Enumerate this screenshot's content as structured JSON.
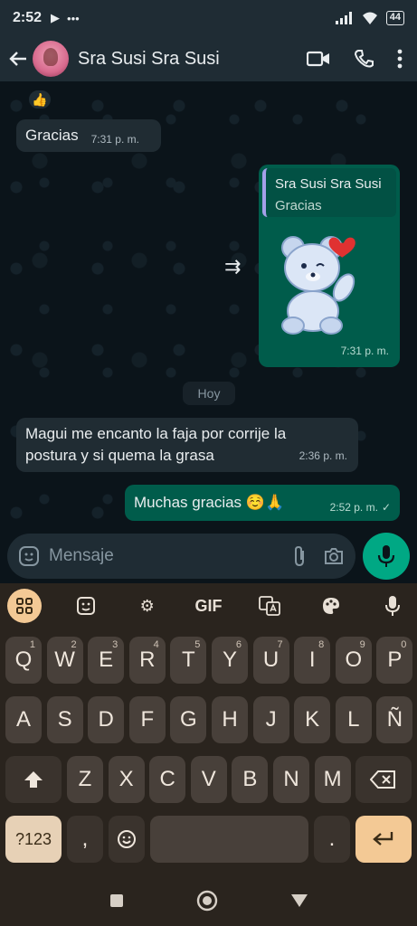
{
  "status_bar": {
    "time": "2:52",
    "battery": "44"
  },
  "header": {
    "contact_name": "Sra Susi Sra Susi"
  },
  "messages": {
    "reaction": "👍",
    "m1": {
      "text": "Gracias",
      "time": "7:31 p. m."
    },
    "m2": {
      "quote_name": "Sra Susi Sra Susi",
      "quote_text": "Gracias",
      "time": "7:31 p. m."
    },
    "day_separator": "Hoy",
    "m3": {
      "text": "Magui me encanto la faja por corrije la postura y si quema la grasa",
      "time": "2:36 p. m."
    },
    "m4": {
      "text": "Muchas gracias ☺️🙏",
      "time": "2:52 p. m."
    }
  },
  "input": {
    "placeholder": "Mensaje"
  },
  "keyboard": {
    "toolbar": {
      "gif": "GIF"
    },
    "row1": [
      {
        "k": "Q",
        "s": "1"
      },
      {
        "k": "W",
        "s": "2"
      },
      {
        "k": "E",
        "s": "3"
      },
      {
        "k": "R",
        "s": "4"
      },
      {
        "k": "T",
        "s": "5"
      },
      {
        "k": "Y",
        "s": "6"
      },
      {
        "k": "U",
        "s": "7"
      },
      {
        "k": "I",
        "s": "8"
      },
      {
        "k": "O",
        "s": "9"
      },
      {
        "k": "P",
        "s": "0"
      }
    ],
    "row2": [
      "A",
      "S",
      "D",
      "F",
      "G",
      "H",
      "J",
      "K",
      "L",
      "Ñ"
    ],
    "row3": [
      "Z",
      "X",
      "C",
      "V",
      "B",
      "N",
      "M"
    ],
    "symbols_key": "?123",
    "comma_key": ",",
    "period_key": "."
  },
  "colors": {
    "outgoing_bubble": "#005c4b",
    "incoming_bubble": "#202c33",
    "accent_green": "#00a884",
    "keyboard_accent": "#f3c995"
  }
}
